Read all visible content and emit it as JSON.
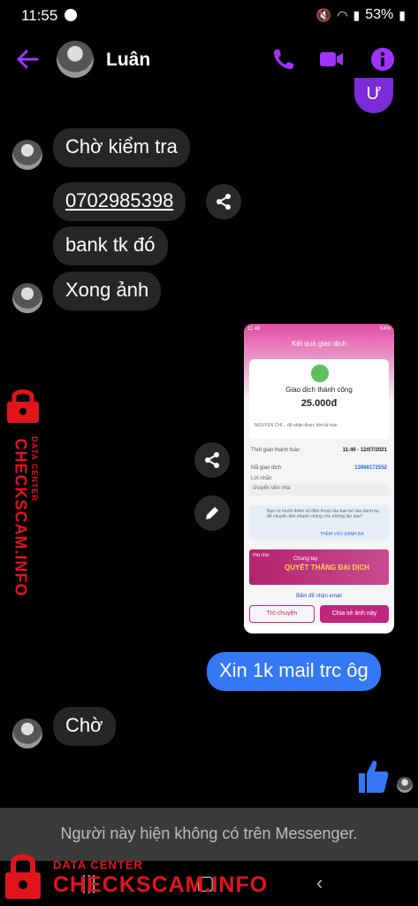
{
  "status_bar": {
    "time": "11:55",
    "battery": "53%"
  },
  "header": {
    "contact_name": "Luân"
  },
  "messages": [
    {
      "text": "Ư",
      "from": "me"
    },
    {
      "text": "Chờ kiểm tra",
      "from": "them"
    },
    {
      "text": "0702985398",
      "from": "them",
      "link": true
    },
    {
      "text": "bank tk đó",
      "from": "them"
    },
    {
      "text": "Xong ảnh",
      "from": "them"
    },
    {
      "text": "Xin 1k mail trc ôg",
      "from": "me"
    },
    {
      "text": "Chờ",
      "from": "them"
    }
  ],
  "screenshot": {
    "status_time": "11:49",
    "status_battery": "54%",
    "title": "Kết quả giao dịch",
    "status": "Giao dịch thành công",
    "amount": "25.000đ",
    "notice": "NGUYEN CHI... đã nhận được tiền từ bạn",
    "time_label": "Thời gian thanh toán",
    "time_value": "11:49 - 12/07/2021",
    "code_label": "Mã giao dịch",
    "code_value": "13968172552",
    "message_label": "Lời nhắn",
    "message_value": "chuyển tiền nha",
    "suggestion": "Bạn có muốn thêm số điện thoại của bạn bè vào danh bạ để chuyển tiền nhanh chóng cho những lần sau?",
    "add_contact": "THÊM VÀO DANH BẠ",
    "banner_brand": "mo mo",
    "banner_line1": "Chung tay",
    "banner_line2": "QUYẾT THẮNG ĐẠI DỊCH",
    "email_link": "Bấm để nhận email",
    "btn_chat": "Trò chuyện",
    "btn_share": "Chia sẻ ảnh này"
  },
  "notice": "Người này hiện không có trên Messenger.",
  "watermark": {
    "line1": "DATA CENTER",
    "line2": "CHECKSCAM.INFO"
  },
  "colors": {
    "accent": "#a033ff",
    "my_bubble": "#3478f6",
    "their_bubble": "#262626",
    "watermark": "#e2141b"
  }
}
